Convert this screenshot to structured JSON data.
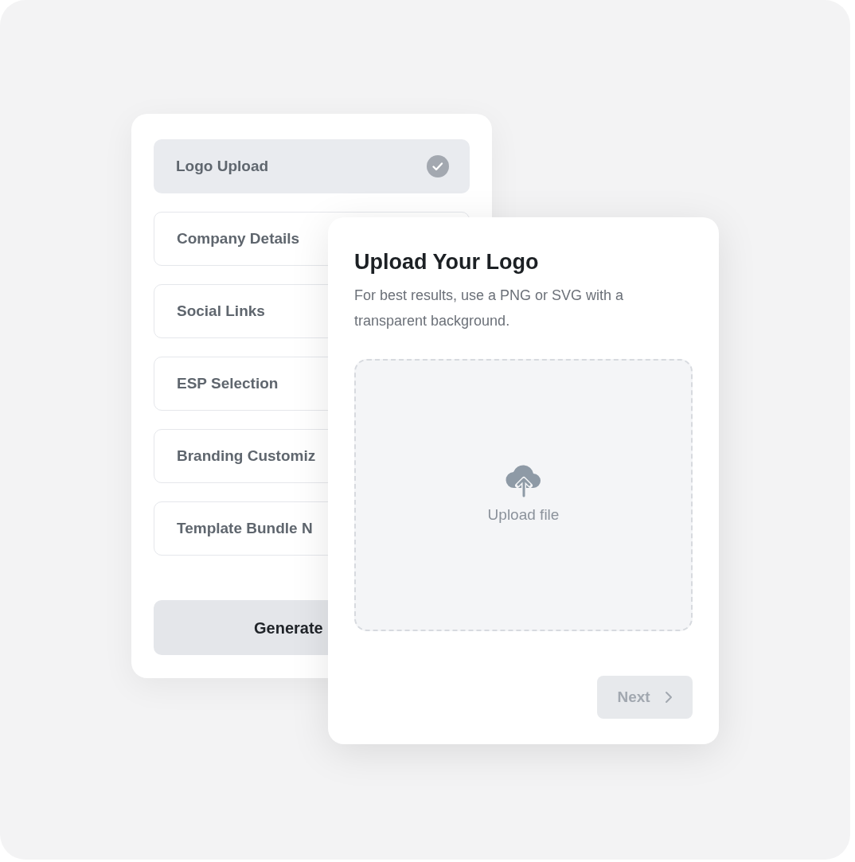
{
  "steps": [
    {
      "label": "Logo Upload",
      "selected": true
    },
    {
      "label": "Company Details",
      "selected": false
    },
    {
      "label": "Social Links",
      "selected": false
    },
    {
      "label": "ESP Selection",
      "selected": false
    },
    {
      "label": "Branding Customiz",
      "selected": false
    },
    {
      "label": "Template Bundle N",
      "selected": false
    }
  ],
  "generate_button": {
    "label": "Generate"
  },
  "upload_card": {
    "title": "Upload Your Logo",
    "description": "For best results, use a PNG or SVG with a transparent background.",
    "dropzone": {
      "label": "Upload file"
    },
    "next_button": {
      "label": "Next",
      "disabled": true
    }
  }
}
